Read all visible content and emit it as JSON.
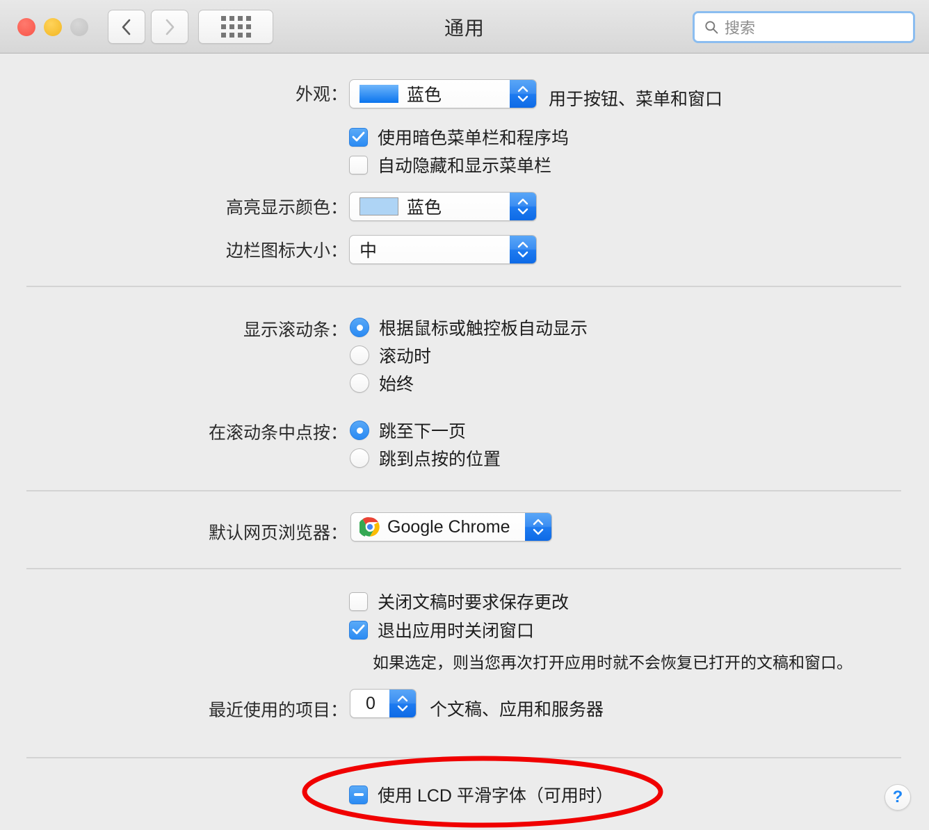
{
  "window": {
    "title": "通用",
    "traffic_lights": [
      "close",
      "minimize",
      "zoom"
    ],
    "nav": {
      "back": "back-arrow",
      "forward": "forward-arrow",
      "grid": "show-all-grid"
    },
    "search": {
      "placeholder": "搜索",
      "value": "",
      "icon": "search-icon"
    }
  },
  "appearance": {
    "label": "外观：",
    "value": "蓝色",
    "swatch_color": "#0a74ee",
    "hint": "用于按钮、菜单和窗口",
    "dark_menu_bar": {
      "label": "使用暗色菜单栏和程序坞",
      "checked": true
    },
    "auto_hide_menu_bar": {
      "label": "自动隐藏和显示菜单栏",
      "checked": false
    }
  },
  "highlight": {
    "label": "高亮显示颜色：",
    "value": "蓝色",
    "swatch_color": "#aed4f5"
  },
  "sidebar_icon_size": {
    "label": "边栏图标大小：",
    "value": "中"
  },
  "show_scrollbars": {
    "label": "显示滚动条：",
    "options": [
      {
        "label": "根据鼠标或触控板自动显示",
        "selected": true
      },
      {
        "label": "滚动时",
        "selected": false
      },
      {
        "label": "始终",
        "selected": false
      }
    ]
  },
  "click_scrollbar": {
    "label": "在滚动条中点按：",
    "options": [
      {
        "label": "跳至下一页",
        "selected": true
      },
      {
        "label": "跳到点按的位置",
        "selected": false
      }
    ]
  },
  "default_browser": {
    "label": "默认网页浏览器：",
    "value": "Google Chrome",
    "icon": "chrome-icon"
  },
  "documents": {
    "ask_save_changes": {
      "label": "关闭文稿时要求保存更改",
      "checked": false
    },
    "close_windows_on_quit": {
      "label": "退出应用时关闭窗口",
      "checked": true
    },
    "note": "如果选定，则当您再次打开应用时就不会恢复已打开的文稿和窗口。"
  },
  "recent_items": {
    "label": "最近使用的项目：",
    "value": "0",
    "trailing": "个文稿、应用和服务器"
  },
  "lcd_smoothing": {
    "label": "使用 LCD 平滑字体（可用时）",
    "state": "mixed"
  },
  "help": {
    "label": "?"
  },
  "colors": {
    "accent": "#2b8bf3",
    "annotation": "#f00000",
    "background": "#ececec",
    "separator": "#d3d3d3"
  }
}
